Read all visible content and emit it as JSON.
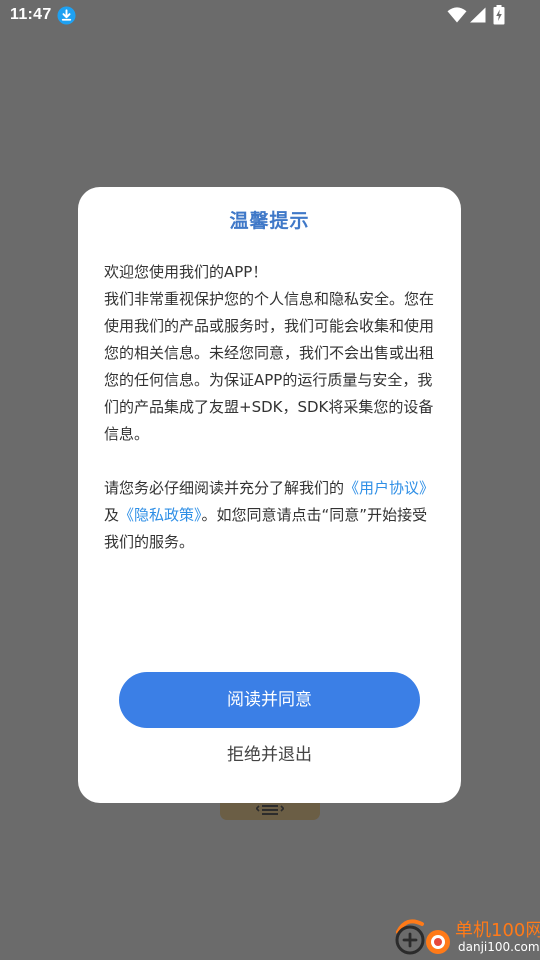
{
  "status_bar": {
    "time": "11:47",
    "icons": [
      "download-notification-icon",
      "wifi-icon",
      "cell-signal-icon",
      "battery-charging-icon"
    ]
  },
  "dialog": {
    "title": "温馨提示",
    "body": {
      "line1": "欢迎您使用我们的APP！",
      "paragraph1": "我们非常重视保护您的个人信息和隐私安全。您在使用我们的产品或服务时，我们可能会收集和使用您的相关信息。未经您同意，我们不会出售或出租您的任何信息。为保证APP的运行质量与安全，我们的产品集成了友盟+SDK，SDK将采集您的设备信息。",
      "p2_before": "请您务必仔细阅读并充分了解我们的",
      "user_agreement_link": "《用户协议》",
      "p2_and": "及",
      "privacy_policy_link": "《隐私政策》",
      "p2_after": "。如您同意请点击“同意”开始接受我们的服务。"
    },
    "agree_label": "阅读并同意",
    "reject_label": "拒绝并退出"
  },
  "watermark": {
    "title": "单机100网",
    "url": "danji100.com"
  },
  "colors": {
    "overlay": "#6b6b6b",
    "title": "#3f78c8",
    "link": "#2f8fe6",
    "primary_button": "#3b7fe6",
    "watermark_orange": "#ff7a18"
  }
}
